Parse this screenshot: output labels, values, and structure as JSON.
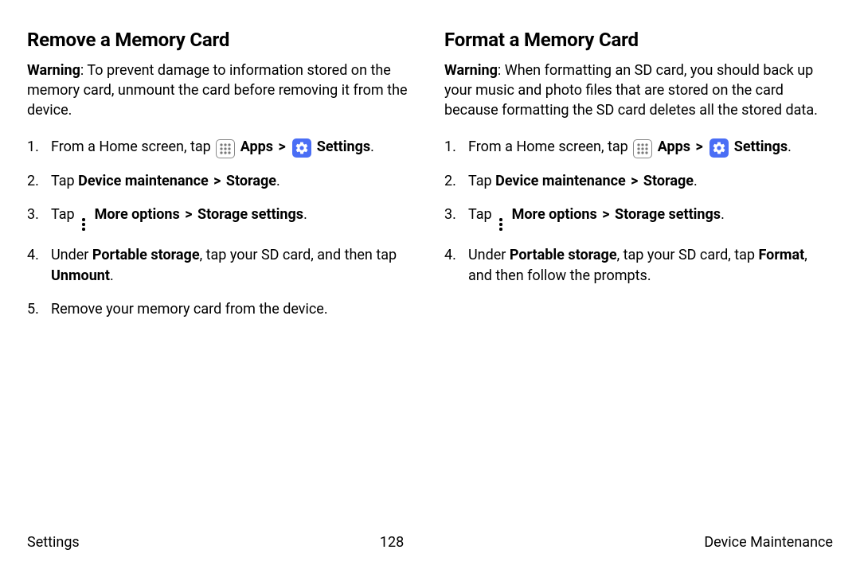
{
  "left": {
    "heading": "Remove a Memory Card",
    "warning_label": "Warning",
    "warning_text": ": To prevent damage to information stored on the memory card, unmount the card before removing it from the device.",
    "step1_pre": "From a Home screen, tap ",
    "apps_label": "Apps",
    "settings_label": "Settings",
    "step2_pre": "Tap ",
    "step2_b1": "Device maintenance",
    "step2_b2": "Storage",
    "step3_pre": "Tap ",
    "step3_b1": "More options",
    "step3_b2": "Storage settings",
    "step4_pre": "Under ",
    "step4_b1": "Portable storage",
    "step4_mid": ", tap your SD card, and then tap ",
    "step4_b2": "Unmount",
    "step5": "Remove your memory card from the device."
  },
  "right": {
    "heading": "Format a Memory Card",
    "warning_label": "Warning",
    "warning_text": ": When formatting an SD card, you should back up your music and photo files that are stored on the card because formatting the SD card deletes all the stored data.",
    "step1_pre": "From a Home screen, tap ",
    "apps_label": "Apps",
    "settings_label": "Settings",
    "step2_pre": "Tap ",
    "step2_b1": "Device maintenance",
    "step2_b2": "Storage",
    "step3_pre": "Tap ",
    "step3_b1": "More options",
    "step3_b2": "Storage settings",
    "step4_pre": "Under ",
    "step4_b1": "Portable storage",
    "step4_mid": ", tap your SD card, tap ",
    "step4_b2": "Format",
    "step4_post": ", and then follow the prompts."
  },
  "sep": ">",
  "period": ".",
  "footer": {
    "left": "Settings",
    "center": "128",
    "right": "Device Maintenance"
  }
}
